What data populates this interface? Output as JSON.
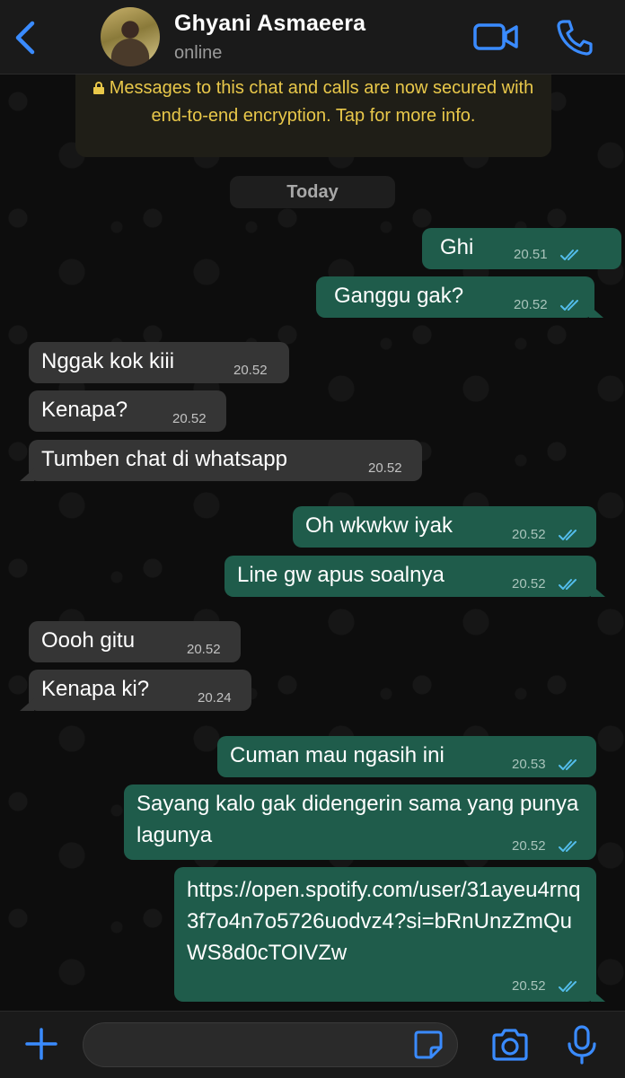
{
  "header": {
    "contact_name": "Ghyani Asmaeera",
    "status": "online",
    "accent": "#3a8bff"
  },
  "encryption_notice": "Messages to this chat and calls are now secured with end-to-end encryption. Tap for more info.",
  "date_divider": "Today",
  "messages": [
    {
      "dir": "out",
      "text": "Ghi",
      "time": "20.51",
      "status": "read"
    },
    {
      "dir": "out",
      "text": "Ganggu gak?",
      "time": "20.52",
      "status": "read"
    },
    {
      "dir": "in",
      "text": "Nggak kok kiii",
      "time": "20.52"
    },
    {
      "dir": "in",
      "text": "Kenapa?",
      "time": "20.52"
    },
    {
      "dir": "in",
      "text": "Tumben chat di whatsapp",
      "time": "20.52"
    },
    {
      "dir": "out",
      "text": "Oh wkwkw iyak",
      "time": "20.52",
      "status": "read"
    },
    {
      "dir": "out",
      "text": "Line gw apus soalnya",
      "time": "20.52",
      "status": "read"
    },
    {
      "dir": "in",
      "text": "Oooh gitu",
      "time": "20.52"
    },
    {
      "dir": "in",
      "text": "Kenapa ki?",
      "time": "20.24"
    },
    {
      "dir": "out",
      "text": "Cuman mau ngasih ini",
      "time": "20.53",
      "status": "read"
    },
    {
      "dir": "out",
      "text": "Sayang kalo gak didengerin sama yang punya lagunya",
      "time": "20.52",
      "status": "read"
    },
    {
      "dir": "out",
      "text": "https://open.spotify.com/user/31ayeu4rnq3f7o4n7o5726uodvz4?si=bRnUnzZmQuWS8d0cTOIVZw",
      "time": "20.52",
      "status": "read"
    }
  ],
  "composer": {
    "value": "",
    "placeholder": ""
  },
  "icons": [
    "back-chevron-icon",
    "video-call-icon",
    "phone-icon",
    "plus-icon",
    "sticker-icon",
    "camera-icon",
    "microphone-icon",
    "lock-icon",
    "double-check-icon"
  ]
}
